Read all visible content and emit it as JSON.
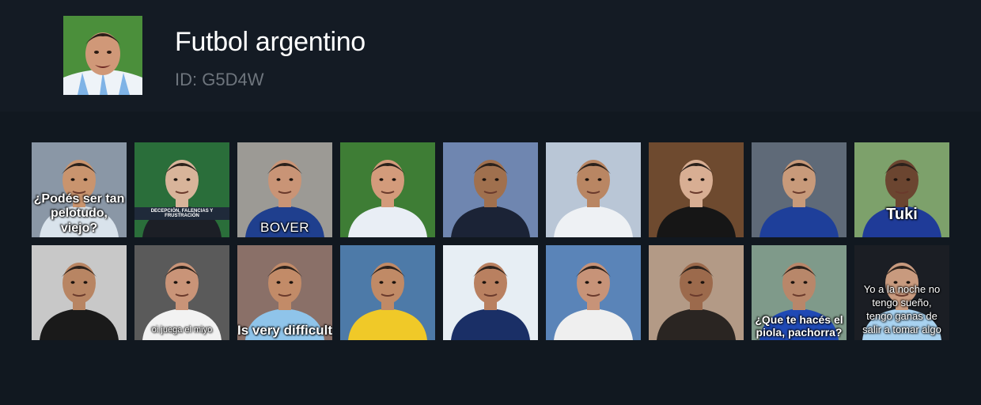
{
  "pack": {
    "title": "Futbol argentino",
    "id_text": "ID: G5D4W",
    "thumbnail_icon": "pack-cover-player"
  },
  "stickers": [
    {
      "caption": "¿Podés ser tan\npelotudo, viejo?",
      "bg": "#8a97a6",
      "skin": "#c9946e",
      "shirt": "#d9e3ec"
    },
    {
      "caption": "",
      "banner": "DECEPCIÓN, FALENCIAS Y FRUSTRACIÓN",
      "bg": "#2a6e3a",
      "skin": "#d8b49a",
      "shirt": "#1c1f26"
    },
    {
      "caption": "BOVER",
      "bg": "#9c9a95",
      "skin": "#c99476",
      "shirt": "#1f3f8e"
    },
    {
      "caption": "",
      "bg": "#3e7d35",
      "skin": "#d39b7b",
      "shirt": "#e9eef5"
    },
    {
      "caption": "",
      "bg": "#6f86b0",
      "skin": "#a0704e",
      "shirt": "#1b2336"
    },
    {
      "caption": "",
      "bg": "#b9c6d6",
      "skin": "#b98663",
      "shirt": "#eef1f4"
    },
    {
      "caption": "",
      "bg": "#6e4a2f",
      "skin": "#d8ae93",
      "shirt": "#161616"
    },
    {
      "caption": "",
      "bg": "#5f6a78",
      "skin": "#c89a7a",
      "shirt": "#1e3f9a"
    },
    {
      "caption": "Tuki",
      "bg": "#7da16b",
      "skin": "#6b4530",
      "shirt": "#1f3b98"
    },
    {
      "caption": "",
      "bg": "#c8c8c8",
      "skin": "#b88563",
      "shirt": "#1a1a1a"
    },
    {
      "caption": "oi juega el miyo",
      "bg": "#5a5a5a",
      "skin": "#c99478",
      "shirt": "#f2f2f2"
    },
    {
      "caption": "Is very difficult",
      "bg": "#8a7068",
      "skin": "#c28b68",
      "shirt": "#8fc4ea"
    },
    {
      "caption": "",
      "bg": "#4d7aa8",
      "skin": "#c08a66",
      "shirt": "#f0c928"
    },
    {
      "caption": "",
      "bg": "#e7eef4",
      "skin": "#b98060",
      "shirt": "#1a2f66"
    },
    {
      "caption": "",
      "bg": "#5a84b8",
      "skin": "#c79378",
      "shirt": "#efefef"
    },
    {
      "caption": "",
      "bg": "#b39a86",
      "skin": "#9c6a4c",
      "shirt": "#2a2522"
    },
    {
      "caption": "¿Que te hacés el\npiola, pachorra?",
      "bg": "#7f9a8a",
      "skin": "#b8876a",
      "shirt": "#1f49b5"
    },
    {
      "caption": "Yo a la noche no\ntengo sueño,\ntengo ganas de\nsalir a tomar algo",
      "bg": "#1b1e24",
      "skin": "#c89a7e",
      "shirt": "#a8d2f0"
    }
  ]
}
